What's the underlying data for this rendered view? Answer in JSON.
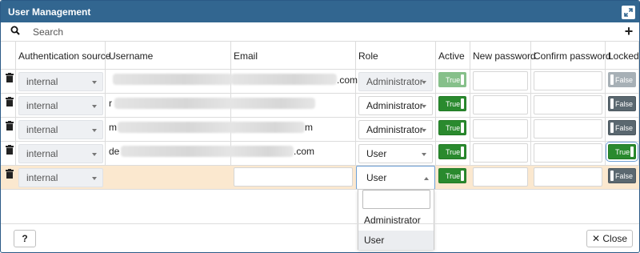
{
  "dialog": {
    "title": "User Management"
  },
  "search": {
    "placeholder": "Search"
  },
  "columns": {
    "auth_source": "Authentication source",
    "username": "Username",
    "email": "Email",
    "role": "Role",
    "active": "Active",
    "new_password": "New password",
    "confirm_password": "Confirm password",
    "locked": "Locked"
  },
  "rows": [
    {
      "auth_source": "internal",
      "username_visible": "",
      "email_visible": ".com",
      "role": "Administrator",
      "active": "True",
      "locked": "False"
    },
    {
      "auth_source": "internal",
      "username_visible": "r",
      "email_visible": "",
      "role": "Administrator",
      "active": "True",
      "locked": "False"
    },
    {
      "auth_source": "internal",
      "username_visible": "m",
      "email_visible": "m",
      "role": "Administrator",
      "active": "True",
      "locked": "False"
    },
    {
      "auth_source": "internal",
      "username_visible": "de",
      "email_visible": ".com",
      "role": "User",
      "active": "True",
      "locked": "True"
    },
    {
      "auth_source": "internal",
      "username_visible": "",
      "email_visible": "",
      "role": "User",
      "active": "True",
      "locked": "False"
    }
  ],
  "role_dropdown": {
    "options": [
      "Administrator",
      "User"
    ],
    "highlighted": "User"
  },
  "footer": {
    "help_label": "?",
    "close_label": "Close"
  },
  "colors": {
    "titlebar": "#326690",
    "active_on": "#2a8a2e",
    "locked_off": "#5b6870",
    "editing_row": "#fbe8cf"
  }
}
